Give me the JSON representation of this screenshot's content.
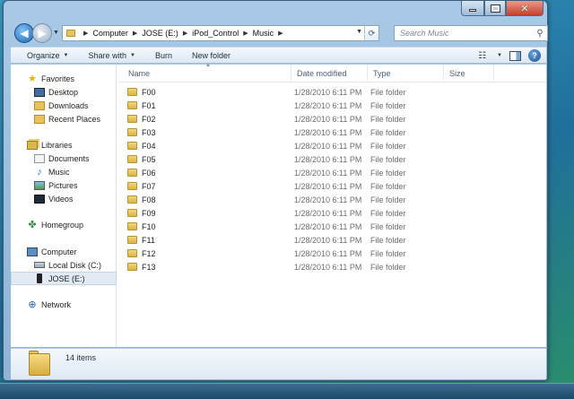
{
  "window": {
    "caption": {
      "minimize_icon": "minimize-icon",
      "maximize_icon": "maximize-icon",
      "close_icon": "close-icon"
    }
  },
  "nav": {
    "back_icon": "back-arrow-icon",
    "forward_icon": "forward-arrow-icon",
    "breadcrumbs": [
      "Computer",
      "JOSE (E:)",
      "iPod_Control",
      "Music"
    ],
    "search_placeholder": "Search Music"
  },
  "toolbar": {
    "organize": "Organize",
    "share_with": "Share with",
    "burn": "Burn",
    "new_folder": "New folder"
  },
  "sidebar": {
    "favorites": {
      "label": "Favorites",
      "items": [
        "Desktop",
        "Downloads",
        "Recent Places"
      ]
    },
    "libraries": {
      "label": "Libraries",
      "items": [
        "Documents",
        "Music",
        "Pictures",
        "Videos"
      ]
    },
    "homegroup": {
      "label": "Homegroup"
    },
    "computer": {
      "label": "Computer",
      "items": [
        "Local Disk (C:)",
        "JOSE (E:)"
      ],
      "selected": "JOSE (E:)"
    },
    "network": {
      "label": "Network"
    }
  },
  "columns": {
    "name": "Name",
    "date": "Date modified",
    "type": "Type",
    "size": "Size"
  },
  "files": [
    {
      "name": "F00",
      "date": "1/28/2010 6:11 PM",
      "type": "File folder"
    },
    {
      "name": "F01",
      "date": "1/28/2010 6:11 PM",
      "type": "File folder"
    },
    {
      "name": "F02",
      "date": "1/28/2010 6:11 PM",
      "type": "File folder"
    },
    {
      "name": "F03",
      "date": "1/28/2010 6:11 PM",
      "type": "File folder"
    },
    {
      "name": "F04",
      "date": "1/28/2010 6:11 PM",
      "type": "File folder"
    },
    {
      "name": "F05",
      "date": "1/28/2010 6:11 PM",
      "type": "File folder"
    },
    {
      "name": "F06",
      "date": "1/28/2010 6:11 PM",
      "type": "File folder"
    },
    {
      "name": "F07",
      "date": "1/28/2010 6:11 PM",
      "type": "File folder"
    },
    {
      "name": "F08",
      "date": "1/28/2010 6:11 PM",
      "type": "File folder"
    },
    {
      "name": "F09",
      "date": "1/28/2010 6:11 PM",
      "type": "File folder"
    },
    {
      "name": "F10",
      "date": "1/28/2010 6:11 PM",
      "type": "File folder"
    },
    {
      "name": "F11",
      "date": "1/28/2010 6:11 PM",
      "type": "File folder"
    },
    {
      "name": "F12",
      "date": "1/28/2010 6:11 PM",
      "type": "File folder"
    },
    {
      "name": "F13",
      "date": "1/28/2010 6:11 PM",
      "type": "File folder"
    }
  ],
  "details": {
    "item_count": "14 items"
  }
}
